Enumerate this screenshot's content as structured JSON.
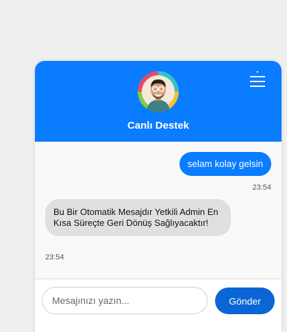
{
  "header": {
    "title": "Canlı Destek",
    "avatar_icon": "support-agent-avatar",
    "menu_icon": "hamburger-menu-icon"
  },
  "messages": [
    {
      "direction": "outgoing",
      "text": "selam kolay gelsin",
      "time": "23:54"
    },
    {
      "direction": "incoming",
      "text": "Bu Bir Otomatik Mesajdır Yetkili Admin En Kısa Süreçte Geri Dönüş Sağlıyacaktır!",
      "time": "23:54"
    }
  ],
  "composer": {
    "placeholder": "Mesajınızı yazın...",
    "value": "",
    "send_label": "Gönder"
  },
  "colors": {
    "accent": "#0a7cff",
    "send_button": "#0a66d4",
    "incoming_bubble": "#e0e0e0"
  }
}
